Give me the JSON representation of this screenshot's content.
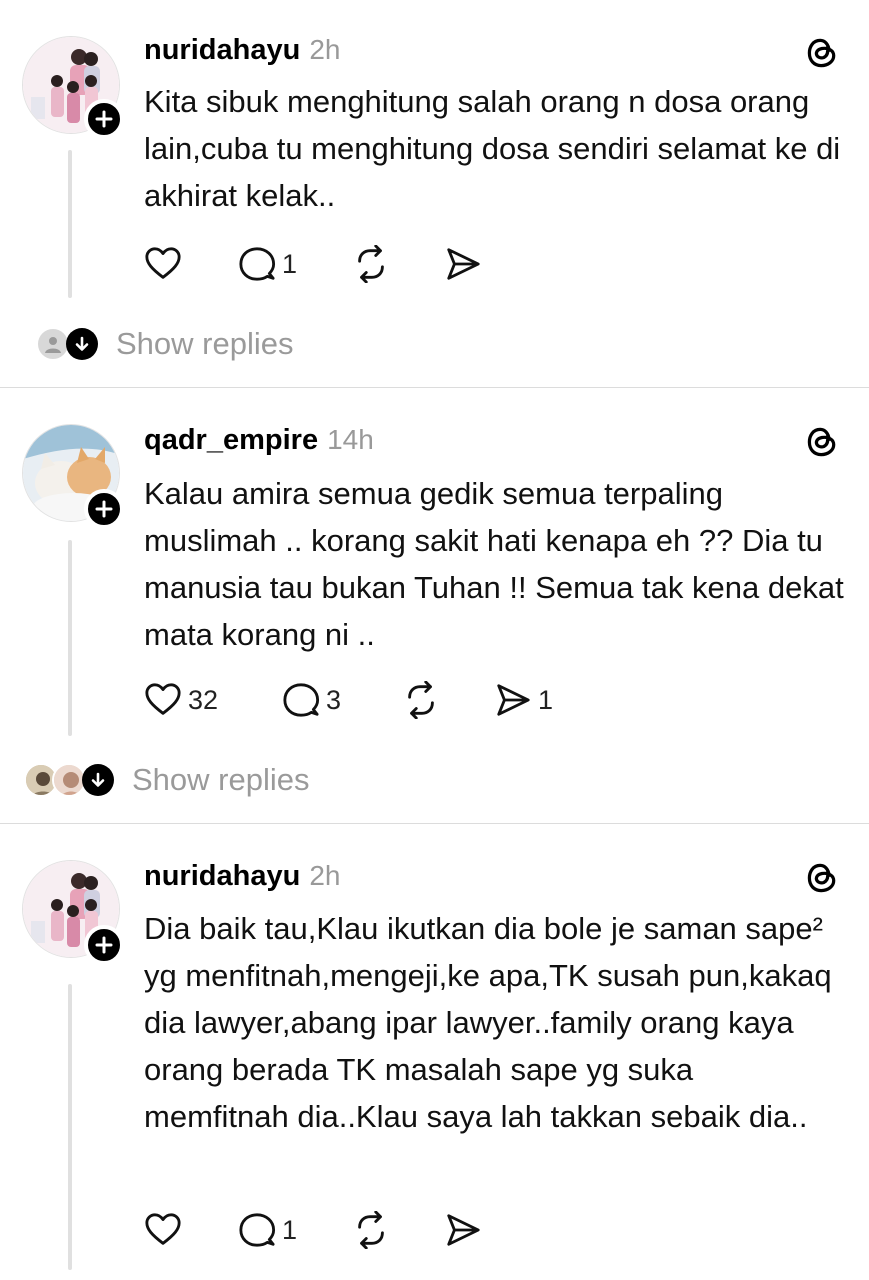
{
  "posts": [
    {
      "username": "nuridahayu",
      "time": "2h",
      "text": "Kita sibuk menghitung salah orang n dosa orang lain,cuba tu menghitung dosa sendiri selamat ke di akhirat kelak..",
      "likes": "",
      "comments": "1",
      "reposts": "",
      "shares": "",
      "show_replies": "Show replies"
    },
    {
      "username": "qadr_empire",
      "time": "14h",
      "text": "Kalau amira semua gedik semua terpaling muslimah .. korang sakit hati kenapa eh ?? Dia tu manusia tau bukan Tuhan !! Semua tak kena dekat mata korang ni ..",
      "likes": "32",
      "comments": "3",
      "reposts": "",
      "shares": "1",
      "show_replies": "Show replies"
    },
    {
      "username": "nuridahayu",
      "time": "2h",
      "text": "Dia baik tau,Klau ikutkan dia bole je saman sape² yg menfitnah,mengeji,ke apa,TK susah pun,kakaq dia lawyer,abang ipar lawyer..family orang kaya orang berada TK masalah sape yg suka memfitnah dia..Klau saya lah takkan sebaik dia..",
      "likes": "",
      "comments": "1",
      "reposts": "",
      "shares": ""
    }
  ],
  "icons": {
    "like": "heart-icon",
    "comment": "comment-icon",
    "repost": "repost-icon",
    "share": "send-icon",
    "platform": "threads-logo-icon",
    "follow": "plus-icon"
  }
}
